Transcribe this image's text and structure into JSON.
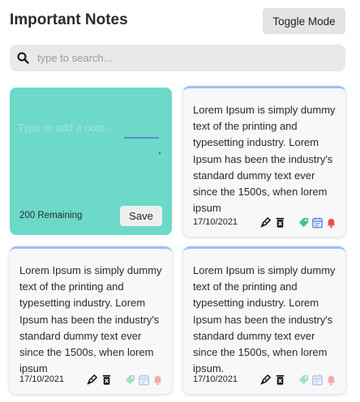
{
  "header": {
    "title": "Important Notes",
    "toggle_label": "Toggle Mode"
  },
  "search": {
    "placeholder": "type to search..."
  },
  "new_note": {
    "placeholder": "Type to add a note...",
    "remaining": "200 Remaining",
    "save_label": "Save"
  },
  "notes": [
    {
      "text": "Lorem Ipsum is simply dummy text of the printing and typesetting industry. Lorem Ipsum has been the industry's standard dummy text ever since the 1500s, when lorem ipsum",
      "date": "17/10/2021",
      "status": "active"
    },
    {
      "text": "Lorem Ipsum is simply dummy text of the printing and typesetting industry. Lorem Ipsum has been the industry's standard dummy text ever since the 1500s, when lorem ipsum",
      "date": "17/10/2021",
      "status": "faded"
    },
    {
      "text": "Lorem Ipsum is simply dummy text of the printing and typesetting industry. Lorem Ipsum has been the industry's standard dummy text ever since the 1500s, when lorem ipsum.",
      "date": "17/10/2021",
      "status": "faded"
    }
  ],
  "colors": {
    "new_note_bg": "#6dd9c9",
    "card_border": "#9cc1ee",
    "tag": "#3fc58a",
    "calendar": "#5b8ee6",
    "alarm": "#ee4c4c"
  }
}
